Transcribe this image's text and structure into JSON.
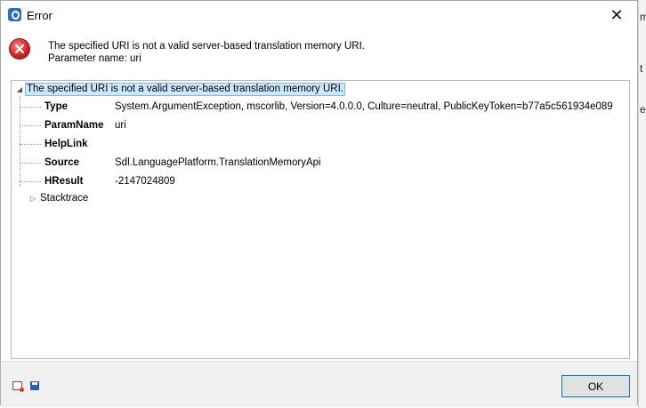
{
  "window": {
    "title": "Error",
    "close_glyph": "✕"
  },
  "message": {
    "line1": "The specified URI is not a valid server-based translation memory URI.",
    "line2": "Parameter name: uri"
  },
  "tree": {
    "root_label": "The specified URI is not a valid server-based translation memory URI.",
    "rows": [
      {
        "key": "Type",
        "value": "System.ArgumentException, mscorlib, Version=4.0.0.0, Culture=neutral, PublicKeyToken=b77a5c561934e089"
      },
      {
        "key": "ParamName",
        "value": "uri"
      },
      {
        "key": "HelpLink",
        "value": ""
      },
      {
        "key": "Source",
        "value": "Sdl.LanguagePlatform.TranslationMemoryApi"
      },
      {
        "key": "HResult",
        "value": "-2147024809"
      }
    ],
    "stacktrace_label": "Stacktrace"
  },
  "footer": {
    "ok_label": "OK"
  },
  "background_app": {
    "fragments": [
      "m",
      "t",
      "e"
    ]
  },
  "colors": {
    "selection_bg": "#cce8ff",
    "selection_border": "#7fb7e6",
    "error_red": "#d42424",
    "focus_blue": "#0078d7"
  }
}
